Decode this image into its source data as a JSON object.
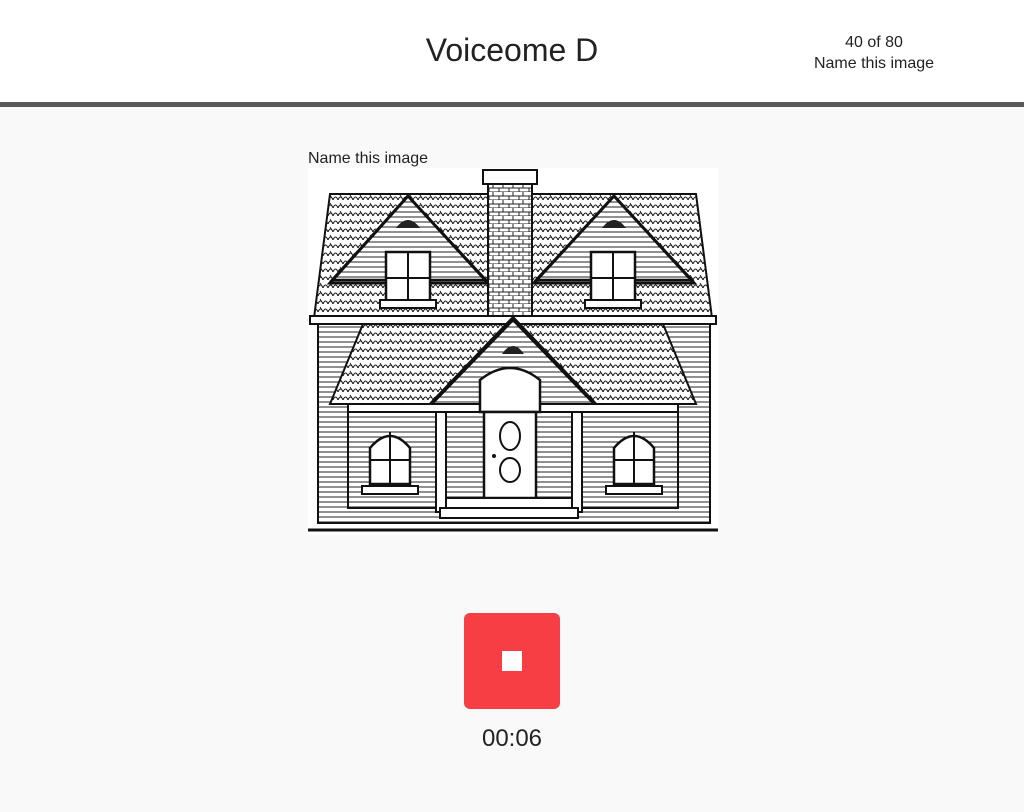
{
  "header": {
    "title": "Voiceome D",
    "progress": "40 of 80",
    "task_name": "Name this image"
  },
  "main": {
    "prompt": "Name this image",
    "stimulus_icon": "house-drawing",
    "record_button_icon": "stop-icon",
    "record_button_color": "#f63e44",
    "timer": "00:06"
  }
}
